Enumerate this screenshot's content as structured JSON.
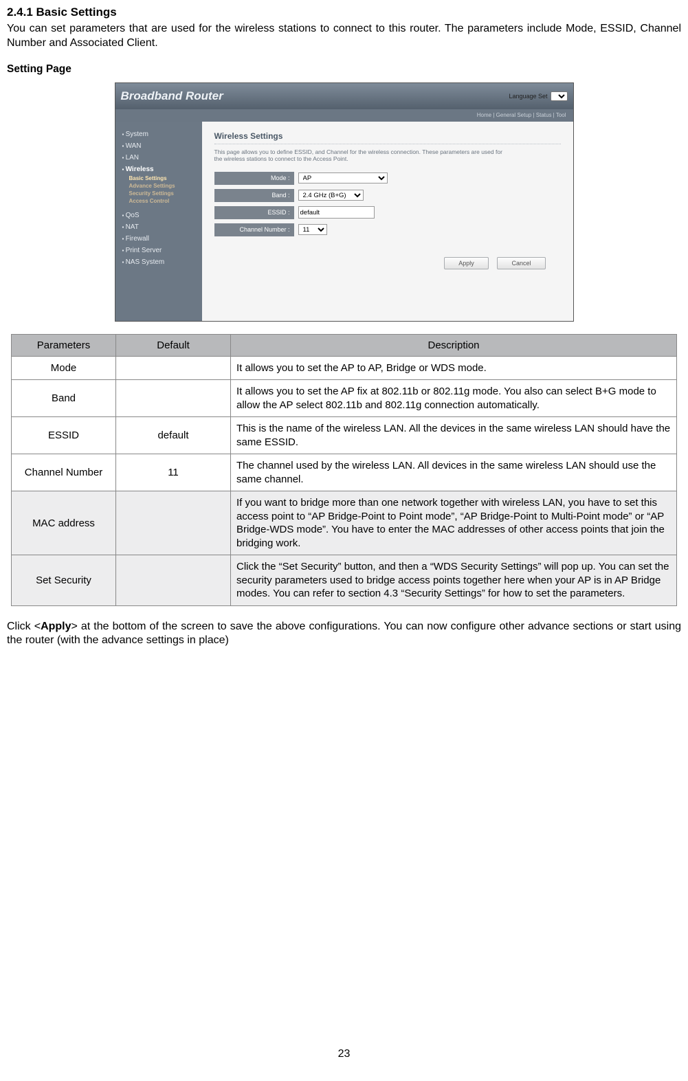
{
  "section_title": "2.4.1 Basic Settings",
  "intro": "You can set parameters that are used for the wireless stations to connect to this router. The parameters include Mode, ESSID, Channel Number and Associated Client.",
  "setting_page_label": "Setting Page",
  "screenshot": {
    "title": "Broadband Router",
    "lang_label": "Language Set",
    "subbar": "Home | General Setup | Status | Tool",
    "sidebar": [
      "System",
      "WAN",
      "LAN",
      "Wireless",
      "QoS",
      "NAT",
      "Firewall",
      "Print Server",
      "NAS System"
    ],
    "wireless_sub": [
      "Basic Settings",
      "Advance Settings",
      "Security Settings",
      "Access Control"
    ],
    "panel_title": "Wireless Settings",
    "panel_desc": "This page allows you to define ESSID, and Channel for the wireless connection. These parameters are used for the wireless stations to connect to the Access Point.",
    "fields": {
      "mode_label": "Mode :",
      "mode_value": "AP",
      "band_label": "Band :",
      "band_value": "2.4 GHz (B+G)",
      "essid_label": "ESSID :",
      "essid_value": "default",
      "channel_label": "Channel Number :",
      "channel_value": "11"
    },
    "apply_btn": "Apply",
    "cancel_btn": "Cancel"
  },
  "table_headers": {
    "c1": "Parameters",
    "c2": "Default",
    "c3": "Description"
  },
  "table_rows": [
    {
      "param": "Mode",
      "def": "",
      "desc": "It allows you to set the AP to AP, Bridge or WDS mode."
    },
    {
      "param": "Band",
      "def": "",
      "desc": "It allows you to set the AP fix at 802.11b or 802.11g mode. You also can select B+G mode to allow the AP select 802.11b and 802.11g connection automatically."
    },
    {
      "param": "ESSID",
      "def": "default",
      "desc": "This is the name of the wireless LAN. All the devices in the same wireless LAN should have the same ESSID."
    },
    {
      "param": "Channel Number",
      "def": "11",
      "desc": "The channel used by the wireless LAN. All devices in the same wireless LAN should use the same channel."
    },
    {
      "param": "MAC address",
      "def": "",
      "desc": "If you want to bridge more than one network together with wireless LAN, you have to set this access point to “AP Bridge-Point to Point mode”, “AP Bridge-Point to Multi-Point mode” or “AP Bridge-WDS mode”. You have to enter the MAC addresses of other access points that join the bridging work."
    },
    {
      "param": "Set Security",
      "def": "",
      "desc": "Click the “Set Security” button, and then a “WDS Security Settings” will pop up. You can set the security parameters used to bridge access points together here when your AP is in AP Bridge modes. You can refer to section 4.3 “Security Settings” for how to set the parameters."
    }
  ],
  "footer_prefix": "Click <",
  "footer_bold": "Apply",
  "footer_suffix": "> at the bottom of the screen to save the above configurations. You can now configure other advance sections or start using the router (with the advance settings in place)",
  "page_number": "23"
}
